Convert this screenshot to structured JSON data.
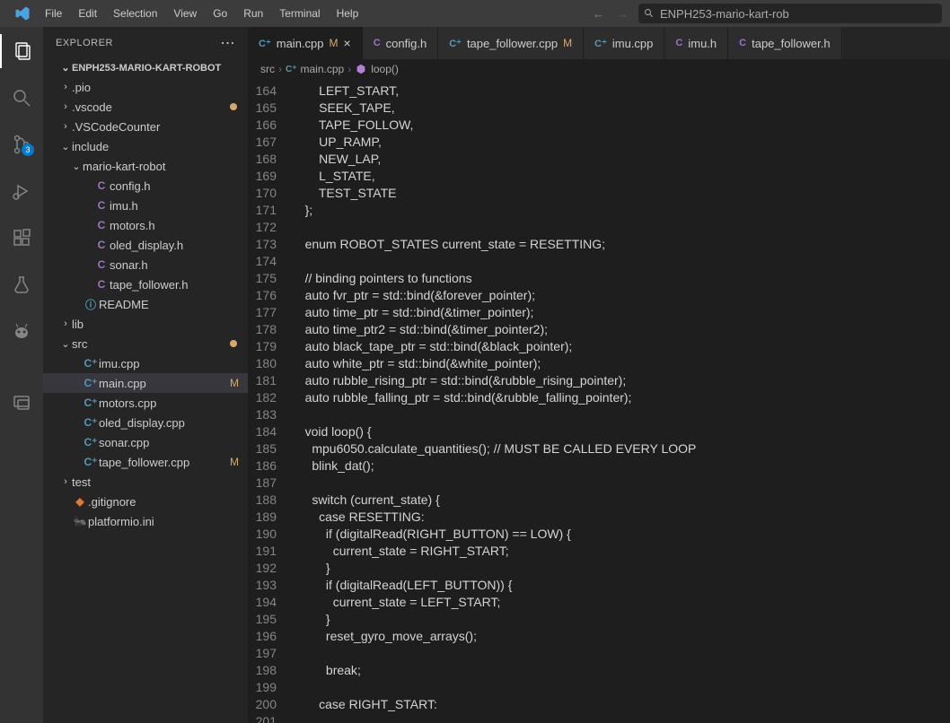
{
  "menu": [
    "File",
    "Edit",
    "Selection",
    "View",
    "Go",
    "Run",
    "Terminal",
    "Help"
  ],
  "search": {
    "placeholder": "ENPH253-mario-kart-rob"
  },
  "sidebar": {
    "title": "EXPLORER",
    "project": "ENPH253-MARIO-KART-ROBOT",
    "tree": [
      {
        "depth": 1,
        "chev": "›",
        "name": ".pio"
      },
      {
        "depth": 1,
        "chev": "›",
        "name": ".vscode",
        "dirty": true
      },
      {
        "depth": 1,
        "chev": "›",
        "name": ".VSCodeCounter"
      },
      {
        "depth": 1,
        "chev": "⌄",
        "name": "include"
      },
      {
        "depth": 2,
        "chev": "⌄",
        "name": "mario-kart-robot"
      },
      {
        "depth": 3,
        "icon": "C",
        "cls": "h",
        "name": "config.h"
      },
      {
        "depth": 3,
        "icon": "C",
        "cls": "h",
        "name": "imu.h"
      },
      {
        "depth": 3,
        "icon": "C",
        "cls": "h",
        "name": "motors.h"
      },
      {
        "depth": 3,
        "icon": "C",
        "cls": "h",
        "name": "oled_display.h"
      },
      {
        "depth": 3,
        "icon": "C",
        "cls": "h",
        "name": "sonar.h"
      },
      {
        "depth": 3,
        "icon": "C",
        "cls": "h",
        "name": "tape_follower.h"
      },
      {
        "depth": 2,
        "icon": "ⓘ",
        "cls": "rm",
        "name": "README"
      },
      {
        "depth": 1,
        "chev": "›",
        "name": "lib"
      },
      {
        "depth": 1,
        "chev": "⌄",
        "name": "src",
        "dirty": true
      },
      {
        "depth": 2,
        "icon": "C⁺",
        "cls": "cpp",
        "name": "imu.cpp"
      },
      {
        "depth": 2,
        "icon": "C⁺",
        "cls": "cpp",
        "name": "main.cpp",
        "mod": "M",
        "sel": true
      },
      {
        "depth": 2,
        "icon": "C⁺",
        "cls": "cpp",
        "name": "motors.cpp"
      },
      {
        "depth": 2,
        "icon": "C⁺",
        "cls": "cpp",
        "name": "oled_display.cpp"
      },
      {
        "depth": 2,
        "icon": "C⁺",
        "cls": "cpp",
        "name": "sonar.cpp"
      },
      {
        "depth": 2,
        "icon": "C⁺",
        "cls": "cpp",
        "name": "tape_follower.cpp",
        "mod": "M"
      },
      {
        "depth": 1,
        "chev": "›",
        "name": "test"
      },
      {
        "depth": 1,
        "icon": "◆",
        "cls": "gi",
        "name": ".gitignore"
      },
      {
        "depth": 1,
        "icon": "🐜",
        "cls": "ini",
        "name": "platformio.ini"
      }
    ]
  },
  "tabs": [
    {
      "icon": "C⁺",
      "cls": "tc-cpp",
      "name": "main.cpp",
      "mod": "M",
      "active": true,
      "close": true
    },
    {
      "icon": "C",
      "cls": "tc-h",
      "name": "config.h"
    },
    {
      "icon": "C⁺",
      "cls": "tc-cpp",
      "name": "tape_follower.cpp",
      "mod": "M"
    },
    {
      "icon": "C⁺",
      "cls": "tc-cpp",
      "name": "imu.cpp"
    },
    {
      "icon": "C",
      "cls": "tc-h",
      "name": "imu.h"
    },
    {
      "icon": "C",
      "cls": "tc-h",
      "name": "tape_follower.h"
    }
  ],
  "crumbs": [
    "src",
    "main.cpp",
    "loop()"
  ],
  "scm_badge": "3",
  "code": {
    "start": 164,
    "lines": [
      "        <cn>LEFT_START</cn><pn>,</pn>",
      "        <cn>SEEK_TAPE</cn><pn>,</pn>",
      "        <cn>TAPE_FOLLOW</cn><pn>,</pn>",
      "        <cn>UP_RAMP</cn><pn>,</pn>",
      "        <cn>NEW_LAP</cn><pn>,</pn>",
      "        <cn>L_STATE</cn><pn>,</pn>",
      "        <cn>TEST_STATE</cn>",
      "    <pn>};</pn>",
      "",
      "    <kw>enum</kw> <tn>ROBOT_STATES</tn> <vr>current_state</vr> <op>=</op> <cn>RESETTING</cn><pn>;</pn>",
      "",
      "    <cm>// binding pointers to functions</cm>",
      "    <kw>auto</kw> <vr>fvr_ptr</vr> <op>=</op> <tn>std</tn><pn>::</pn><fn>bind</fn><pn>(&</pn><vr>forever_pointer</vr><pn>);</pn>",
      "    <kw>auto</kw> <vr>time_ptr</vr> <op>=</op> <tn>std</tn><pn>::</pn><fn>bind</fn><pn>(&</pn><vr>timer_pointer</vr><pn>);</pn>",
      "    <kw>auto</kw> <vr>time_ptr2</vr> <op>=</op> <tn>std</tn><pn>::</pn><fn>bind</fn><pn>(&</pn><vr>timer_pointer2</vr><pn>);</pn>",
      "    <kw>auto</kw> <vr>black_tape_ptr</vr> <op>=</op> <tn>std</tn><pn>::</pn><fn>bind</fn><pn>(&</pn><vr>black_pointer</vr><pn>);</pn>",
      "    <kw>auto</kw> <vr>white_ptr</vr> <op>=</op> <tn>std</tn><pn>::</pn><fn>bind</fn><pn>(&</pn><vr>white_pointer</vr><pn>);</pn>",
      "    <kw>auto</kw> <vr>rubble_rising_ptr</vr> <op>=</op> <tn>std</tn><pn>::</pn><fn>bind</fn><pn>(&</pn><vr>rubble_rising_pointer</vr><pn>);</pn>",
      "    <kw>auto</kw> <vr>rubble_falling_ptr</vr> <op>=</op> <tn>std</tn><pn>::</pn><fn>bind</fn><pn>(&</pn><vr>rubble_falling_pointer</vr><pn>);</pn>",
      "",
      "    <kw>void</kw> <fn>loop</fn><pn>() {</pn>",
      "      <vr>mpu6050</vr><pn>.</pn><fn>calculate_quantities</fn><pn>();</pn> <cm>// MUST BE CALLED EVERY LOOP</cm>",
      "      <fn>blink_dat</fn><pn>();</pn>",
      "",
      "      <cf>switch</cf> <pn>(</pn><vr>current_state</vr><pn>) {</pn>",
      "        <cf>case</cf> <cn>RESETTING</cn><pn>:</pn>",
      "          <cf>if</cf> <pn>(</pn><fn>digitalRead</fn><pn>(</pn><cn>RIGHT_BUTTON</cn><pn>)</pn> <op>==</op> <kc>LOW</kc><pn>) {</pn>",
      "            <vr>current_state</vr> <op>=</op> <cn>RIGHT_START</cn><pn>;</pn>",
      "          <pn>}</pn>",
      "          <cf>if</cf> <pn>(</pn><fn>digitalRead</fn><pn>(</pn><cn>LEFT_BUTTON</cn><pn>)) {</pn>",
      "            <vr>current_state</vr> <op>=</op> <cn>LEFT_START</cn><pn>;</pn>",
      "          <pn>}</pn>",
      "          <fn>reset_gyro_move_arrays</fn><pn>();</pn>",
      "",
      "          <cf>break</cf><pn>;</pn>",
      "",
      "        <cf>case</cf> <cn>RIGHT_START</cn><pn>:</pn>",
      ""
    ]
  }
}
